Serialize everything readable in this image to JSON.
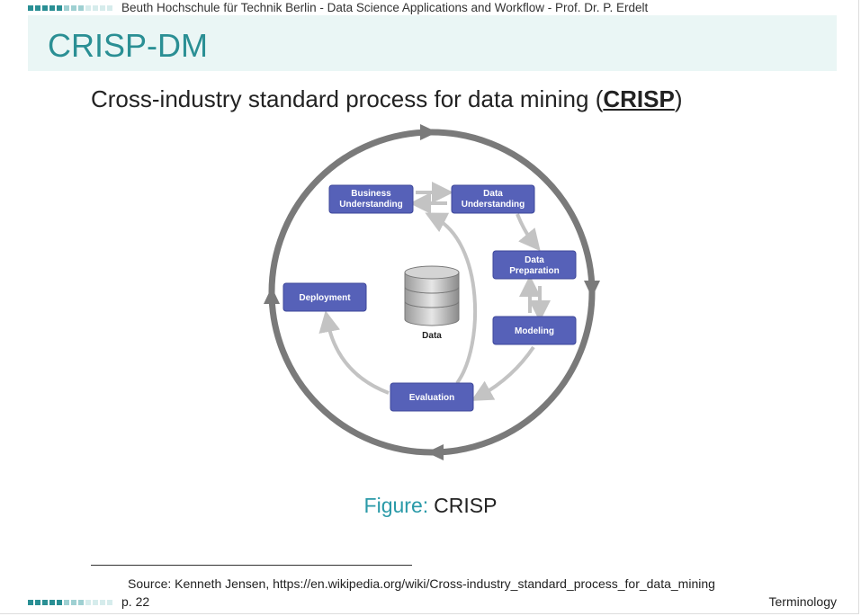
{
  "header": {
    "text": "Beuth Hochschule für Technik Berlin - Data Science Applications and Workflow - Prof. Dr. P. Erdelt",
    "square_colors": [
      "#2a8f94",
      "#2a8f94",
      "#2a8f94",
      "#2a8f94",
      "#2a8f94",
      "#9fd0d2",
      "#9fd0d2",
      "#9fd0d2",
      "#d6ecec",
      "#d6ecec",
      "#d6ecec",
      "#d6ecec"
    ]
  },
  "slide": {
    "title": "CRISP-DM",
    "heading_prefix": "Cross-industry standard process for data mining (",
    "heading_acronym": "CRISP",
    "heading_suffix": ")"
  },
  "diagram": {
    "nodes": {
      "business_understanding": [
        "Business",
        "Understanding"
      ],
      "data_understanding": [
        "Data",
        "Understanding"
      ],
      "data_preparation": [
        "Data",
        "Preparation"
      ],
      "modeling": "Modeling",
      "evaluation": "Evaluation",
      "deployment": "Deployment"
    },
    "center_label": "Data",
    "colors": {
      "node_fill": "#5661b8",
      "node_stroke": "#3d479a",
      "outer_circle": "#7a7a7a",
      "inner_arrows": "#c3c3c3"
    }
  },
  "caption": {
    "label": "Figure:",
    "text": "CRISP"
  },
  "footnote": {
    "source": "Source: Kenneth Jensen, https://en.wikipedia.org/wiki/Cross-industry_standard_process_for_data_mining"
  },
  "footer": {
    "page": "p. 22",
    "section": "Terminology"
  }
}
